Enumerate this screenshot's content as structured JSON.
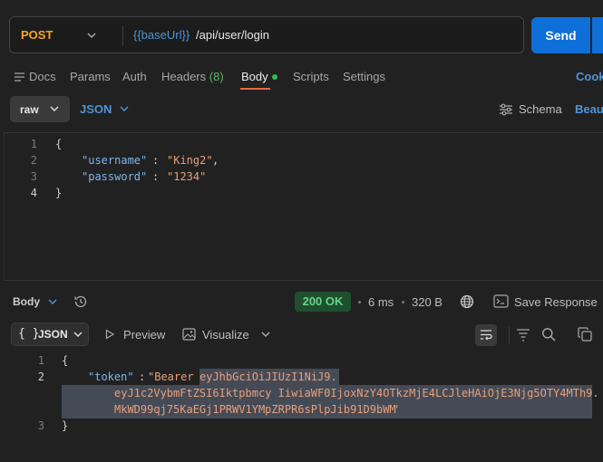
{
  "request": {
    "method": "POST",
    "url_variable": "{{baseUrl}}",
    "url_path": "/api/user/login",
    "send_label": "Send"
  },
  "tabs": {
    "docs": "Docs",
    "params": "Params",
    "auth": "Auth",
    "headers": "Headers",
    "headers_count": "(8)",
    "body": "Body",
    "scripts": "Scripts",
    "settings": "Settings",
    "cookies": "Cook"
  },
  "body_options": {
    "mode": "raw",
    "language": "JSON",
    "schema": "Schema",
    "beautify": "Beaut"
  },
  "request_body": {
    "lines": [
      "1",
      "2",
      "3",
      "4"
    ],
    "open_brace": "{",
    "close_brace": "}",
    "username_key": "\"username\"",
    "username_value": "\"King2\"",
    "password_key": "\"password\"",
    "password_value": "\"1234\""
  },
  "response_bar": {
    "label": "Body",
    "status": "200 OK",
    "time": "6 ms",
    "size": "320 B",
    "save_response": "Save Response"
  },
  "response_view": {
    "format_braces": "{ }",
    "format": "JSON",
    "preview": "Preview",
    "visualize": "Visualize"
  },
  "response_body": {
    "lines": [
      "1",
      "2",
      "3"
    ],
    "open_brace": "{",
    "close_brace": "}",
    "token_key": "\"token\"",
    "token_prefix": "\"Bearer ",
    "token_line1": "eyJhbGciOiJIUzI1NiJ9.",
    "token_line2": "eyJ1c2VybmFtZSI6Iktpbmcy IiwiaWF0IjoxNzY4OTkzMjE4LCJleHAiOjE3Njg5OTY4MTh9.",
    "token_line3": "MkWD99qj75KaEGj1PRWV1YMpZRPR6sPlpJib91D9bWM",
    "token_suffix": "\""
  },
  "colors": {
    "accent": "#0e6fd8",
    "method": "#f5a623",
    "status_ok": "#66d68a",
    "tab_active": "#e86a3c"
  }
}
